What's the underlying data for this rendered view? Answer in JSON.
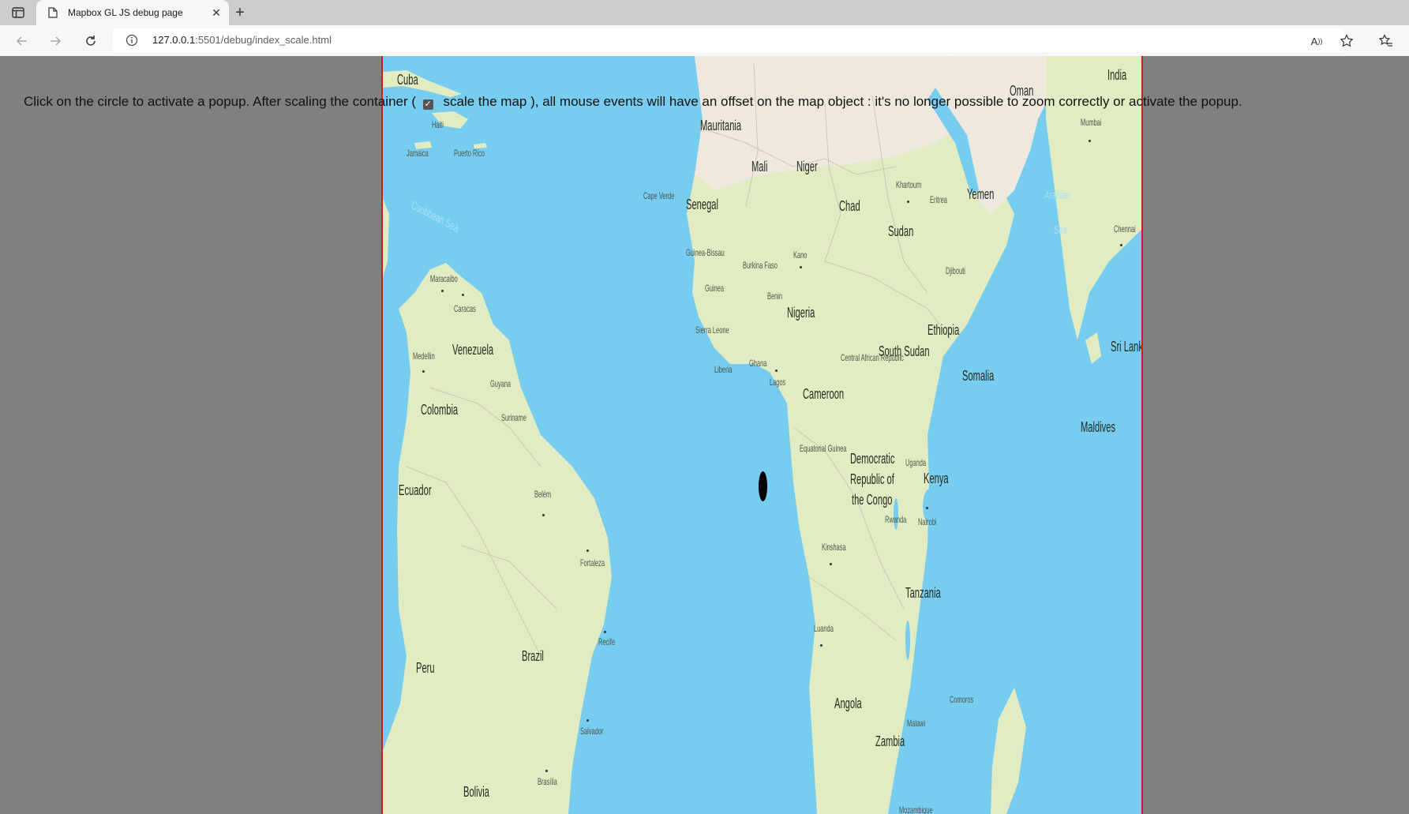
{
  "browser": {
    "tab_title": "Mapbox GL JS debug page",
    "url_host": "127.0.0.1",
    "url_rest": ":5501/debug/index_scale.html"
  },
  "page": {
    "instruction_before": "Click on the circle to activate a popup. After scaling the container (",
    "checkbox_label": "scale the map",
    "instruction_after": " ), all mouse events will have an offset on the map object : it's no longer possible to zoom correctly or activate the popup.",
    "checkbox_checked": true
  },
  "map": {
    "labels": {
      "cuba": "Cuba",
      "haiti": "Haiti",
      "jamaica": "Jamaica",
      "puerto_rico": "Puerto Rico",
      "caribbean_sea": "Caribbean Sea",
      "maracaibo": "Maracaibo",
      "caracas": "Caracas",
      "venezuela": "Venezuela",
      "medellin": "Medellin",
      "guyana": "Guyana",
      "suriname": "Suriname",
      "colombia": "Colombia",
      "ecuador": "Ecuador",
      "belem": "Belém",
      "fortaleza": "Fortaleza",
      "recife": "Recife",
      "peru": "Peru",
      "brazil": "Brazil",
      "salvador": "Salvador",
      "brasilia": "Brasília",
      "bolivia": "Bolivia",
      "mauritania": "Mauritania",
      "mali": "Mali",
      "niger": "Niger",
      "cape_verde": "Cape Verde",
      "senegal": "Senegal",
      "guinea_bissau": "Guinea-Bissau",
      "guinea": "Guinea",
      "burkina_faso": "Burkina Faso",
      "kano": "Kano",
      "benin": "Benin",
      "nigeria": "Nigeria",
      "sierra_leone": "Sierra Leone",
      "liberia": "Liberia",
      "ghana": "Ghana",
      "lagos": "Lagos",
      "chad": "Chad",
      "khartoum": "Khartoum",
      "sudan": "Sudan",
      "eritrea": "Eritrea",
      "yemen": "Yemen",
      "oman": "Oman",
      "djibouti": "Djibouti",
      "ethiopia": "Ethiopia",
      "car": "Central African Republic",
      "south_sudan": "South Sudan",
      "somalia": "Somalia",
      "cameroon": "Cameroon",
      "eq_guinea": "Equatorial Guinea",
      "drc_1": "Democratic",
      "drc_2": "Republic of",
      "drc_3": "the Congo",
      "uganda": "Uganda",
      "kenya": "Kenya",
      "rwanda": "Rwanda",
      "nairobi": "Nairobi",
      "kinshasa": "Kinshasa",
      "tanzania": "Tanzania",
      "luanda": "Luanda",
      "angola": "Angola",
      "zambia": "Zambia",
      "malawi": "Malawi",
      "comoros": "Comoros",
      "mozambique": "Mozambique",
      "india": "India",
      "mumbai": "Mumbai",
      "arabian_sea_1": "Arabian",
      "arabian_sea_2": "Sea",
      "chennai": "Chennai",
      "sri_lanka": "Sri Lanka",
      "maldives": "Maldives"
    }
  }
}
